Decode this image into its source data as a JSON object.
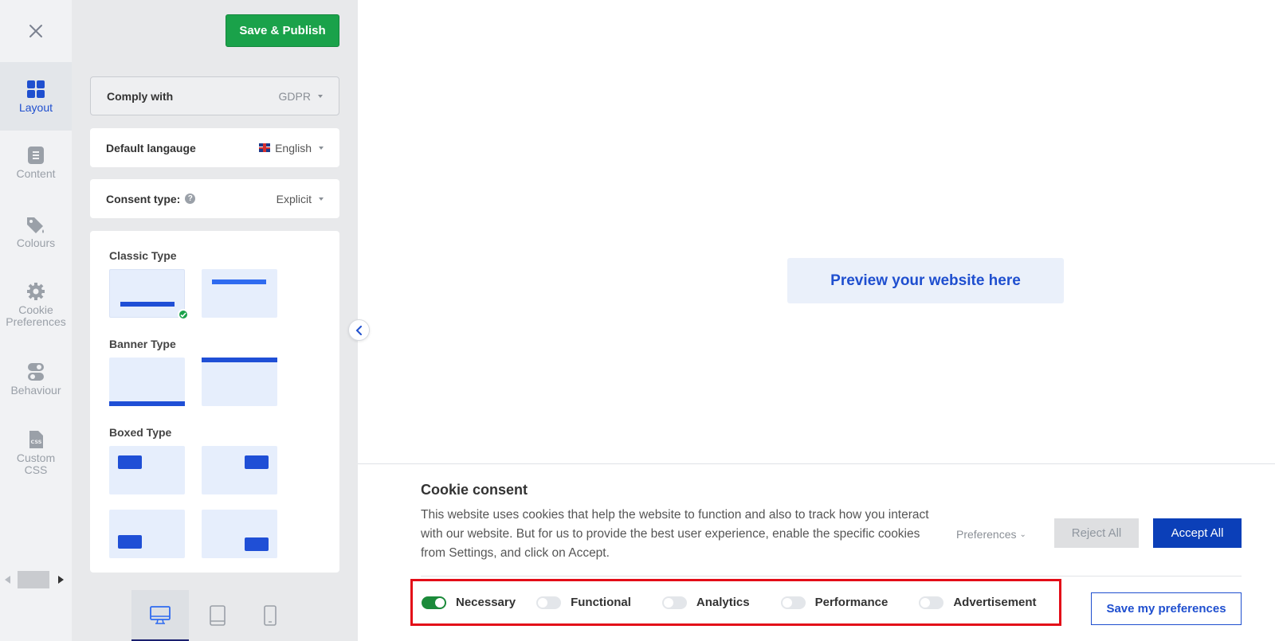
{
  "rail": {
    "items": [
      {
        "label": "Layout",
        "icon": "grid-icon"
      },
      {
        "label": "Content",
        "icon": "document-icon"
      },
      {
        "label": "Colours",
        "icon": "paint-tag-icon"
      },
      {
        "label": "Cookie Preferences",
        "icon": "gear-icon"
      },
      {
        "label": "Behaviour",
        "icon": "toggle-icon"
      },
      {
        "label": "Custom CSS",
        "icon": "css-file-icon"
      }
    ]
  },
  "panel": {
    "publish_label": "Save & Publish",
    "comply": {
      "label": "Comply with",
      "value": "GDPR"
    },
    "language": {
      "label": "Default langauge",
      "value": "English"
    },
    "consent": {
      "label": "Consent type:",
      "value": "Explicit"
    },
    "sections": {
      "classic": "Classic Type",
      "banner": "Banner Type",
      "boxed": "Boxed Type"
    }
  },
  "preview": {
    "label": "Preview your website here"
  },
  "banner": {
    "title": "Cookie consent",
    "description": "This website uses cookies that help the website to function and also to track how you interact with our website. But for us to provide the best user experience, enable the specific cookies from Settings, and click on Accept.",
    "preferences_label": "Preferences",
    "reject_label": "Reject All",
    "accept_label": "Accept All",
    "save_label": "Save my preferences",
    "toggles": [
      {
        "label": "Necessary",
        "on": true
      },
      {
        "label": "Functional",
        "on": false
      },
      {
        "label": "Analytics",
        "on": false
      },
      {
        "label": "Performance",
        "on": false
      },
      {
        "label": "Advertisement",
        "on": false
      }
    ]
  },
  "colors": {
    "accent": "#1f4fcf",
    "publish": "#1aa24a",
    "highlight_border": "#e30d18"
  }
}
